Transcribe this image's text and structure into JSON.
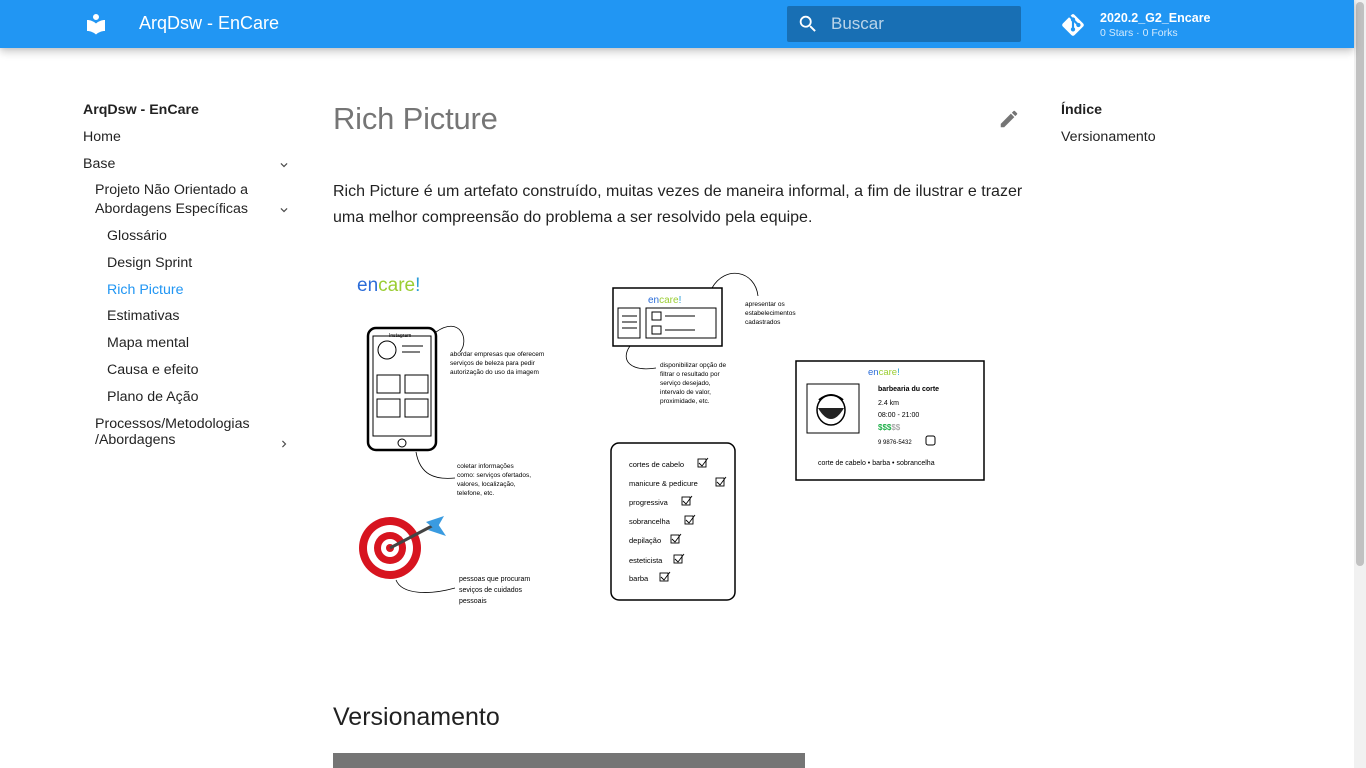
{
  "header": {
    "site_title": "ArqDsw - EnCare",
    "search_placeholder": "Buscar",
    "repo_name": "2020.2_G2_Encare",
    "repo_facts": "0 Stars · 0 Forks"
  },
  "nav": {
    "title": "ArqDsw - EnCare",
    "home": "Home",
    "base": "Base",
    "projeto_line1": "Projeto Não Orientado a",
    "projeto_line2": "Abordagens Específicas",
    "items": [
      "Glossário",
      "Design Sprint",
      "Rich Picture",
      "Estimativas",
      "Mapa mental",
      "Causa e efeito",
      "Plano de Ação"
    ],
    "processos_line1": "Processos/Metodologias",
    "processos_line2": "/Abordagens"
  },
  "main": {
    "title": "Rich Picture",
    "intro_line1": "Rich Picture é um artefato construído, muitas vezes de maneira informal, a fim de ilustrar e trazer",
    "intro_line2": "uma melhor compreensão do problema a ser resolvido pela equipe.",
    "section_title": "Versionamento"
  },
  "toc": {
    "title": "Índice",
    "items": [
      "Versionamento"
    ]
  },
  "figure": {
    "logo_en": "en",
    "logo_care": "care",
    "logo_bang": "!",
    "phone_label": "Instagram",
    "note1": [
      "abordar empresas que oferecem",
      "serviços de beleza para pedir",
      "autorização do uso da imagem"
    ],
    "note2": [
      "coletar informações",
      "como: serviços ofertados,",
      "valores, localização,",
      "telefone, etc."
    ],
    "note3": [
      "pessoas que procuram",
      "seviços de cuidados",
      "pessoais"
    ],
    "note4": [
      "apresentar os",
      "estabelecimentos",
      "cadastrados"
    ],
    "note5": [
      "disponibilizar opção de",
      "filtrar o resultado por",
      "serviço desejado,",
      "intervalo de valor,",
      "proximidade, etc."
    ],
    "services": [
      "cortes de cabelo",
      "manicure & pedicure",
      "progressiva",
      "sobrancelha",
      "depilação",
      "esteticista",
      "barba"
    ],
    "shop_name": "barbearia du corte",
    "shop_distance": "2.4 km",
    "shop_hours": "08:00 - 21:00",
    "shop_price_on": "$$$",
    "shop_price_off": "$$",
    "shop_phone": "9 9876-5432",
    "shop_services": "corte de cabelo • barba • sobrancelha"
  }
}
